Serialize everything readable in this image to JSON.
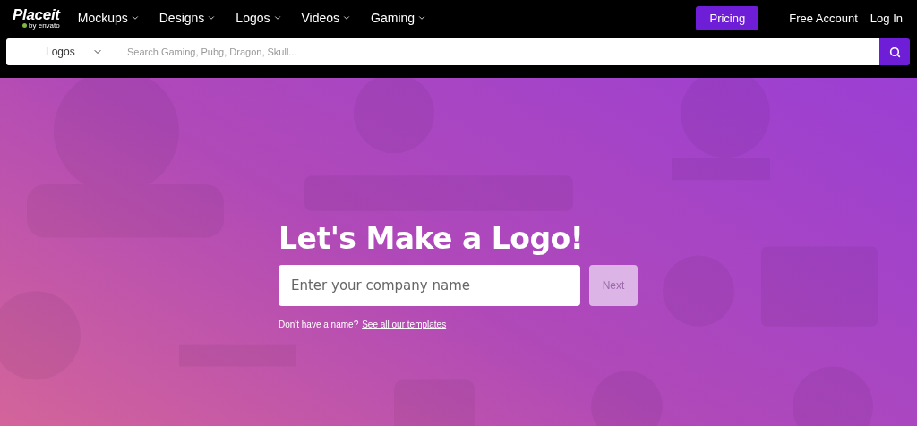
{
  "brand": {
    "name": "Placeit",
    "byline": "by envato"
  },
  "nav": [
    {
      "label": "Mockups"
    },
    {
      "label": "Designs"
    },
    {
      "label": "Logos"
    },
    {
      "label": "Videos"
    },
    {
      "label": "Gaming"
    }
  ],
  "actions": {
    "pricing": "Pricing",
    "free_account": "Free Account",
    "login": "Log In"
  },
  "search": {
    "category": "Logos",
    "placeholder": "Search Gaming, Pubg, Dragon, Skull..."
  },
  "hero": {
    "title": "Let's Make a Logo!",
    "name_field": {
      "placeholder": "Enter your company name"
    },
    "next_button": {
      "label": "Next",
      "disabled": true
    },
    "note": "Don't have a name?",
    "note_link": "See all our templates"
  }
}
